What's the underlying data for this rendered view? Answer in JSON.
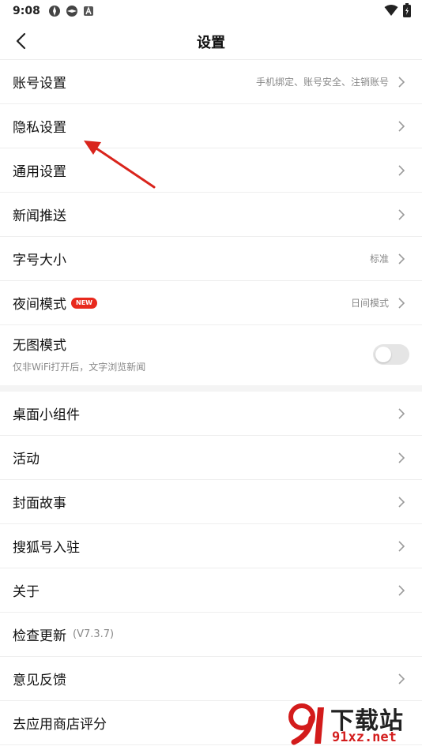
{
  "status_bar": {
    "time": "9:08"
  },
  "nav": {
    "title": "设置"
  },
  "sections": [
    [
      {
        "label": "账号设置",
        "value": "手机绑定、账号安全、注销账号"
      },
      {
        "label": "隐私设置"
      },
      {
        "label": "通用设置"
      },
      {
        "label": "新闻推送"
      },
      {
        "label": "字号大小",
        "value": "标准"
      },
      {
        "label": "夜间模式",
        "badge": "NEW",
        "value": "日间模式"
      },
      {
        "label": "无图模式",
        "subtitle": "仅非WiFi打开后，文字浏览新闻",
        "toggle_on": false
      }
    ],
    [
      {
        "label": "桌面小组件"
      },
      {
        "label": "活动"
      },
      {
        "label": "封面故事"
      },
      {
        "label": "搜狐号入驻"
      },
      {
        "label": "关于"
      },
      {
        "label": "检查更新",
        "version": "(V7.3.7)"
      },
      {
        "label": "意见反馈"
      },
      {
        "label": "去应用商店评分"
      }
    ]
  ],
  "watermark": {
    "text": "下载站",
    "url": "91xz.net"
  },
  "colors": {
    "accent": "#e8291d",
    "annotation_arrow": "#d9241c",
    "divider": "#eeeeee"
  }
}
